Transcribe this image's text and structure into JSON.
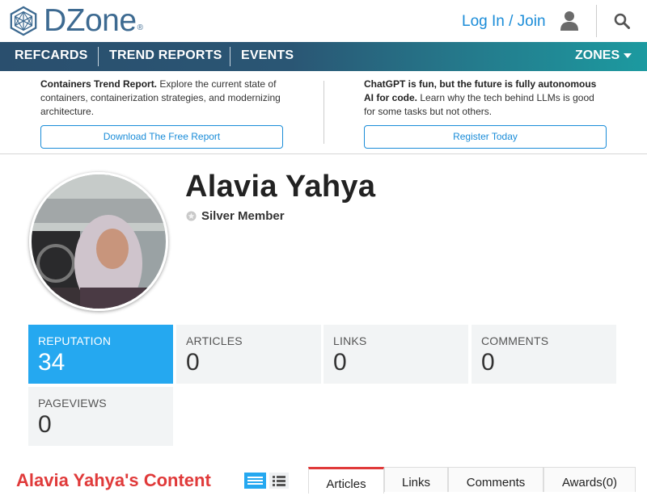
{
  "header": {
    "logo_text": "DZone",
    "logo_reg": "®",
    "login_label": "Log In / Join",
    "user_icon": "user-icon",
    "search_icon": "search-icon"
  },
  "nav": {
    "items": [
      {
        "label": "REFCARDS"
      },
      {
        "label": "TREND REPORTS"
      },
      {
        "label": "EVENTS"
      }
    ],
    "zones_label": "ZONES"
  },
  "promos": [
    {
      "title": "Containers Trend Report.",
      "body": " Explore the current state of containers, containerization strategies, and modernizing architecture.",
      "button": "Download The Free Report"
    },
    {
      "title": "ChatGPT is fun, but the future is fully autonomous AI for code.",
      "body": " Learn why the tech behind LLMs is good for some tasks but not others.",
      "button": "Register Today"
    }
  ],
  "profile": {
    "name": "Alavia Yahya",
    "member_level": "Silver Member"
  },
  "stats": [
    {
      "label": "REPUTATION",
      "value": "34",
      "active": true
    },
    {
      "label": "ARTICLES",
      "value": "0"
    },
    {
      "label": "LINKS",
      "value": "0"
    },
    {
      "label": "COMMENTS",
      "value": "0"
    },
    {
      "label": "PAGEVIEWS",
      "value": "0"
    }
  ],
  "content": {
    "title": "Alavia Yahya's Content",
    "tabs": [
      {
        "label": "Articles",
        "active": true
      },
      {
        "label": "Links"
      },
      {
        "label": "Comments"
      },
      {
        "label": "Awards(0)"
      }
    ]
  },
  "colors": {
    "accent": "#1a8cd8",
    "active_stat": "#25a8f0",
    "title_red": "#e03a3a",
    "nav_start": "#2a4f6e",
    "nav_end": "#1c9aa0"
  }
}
